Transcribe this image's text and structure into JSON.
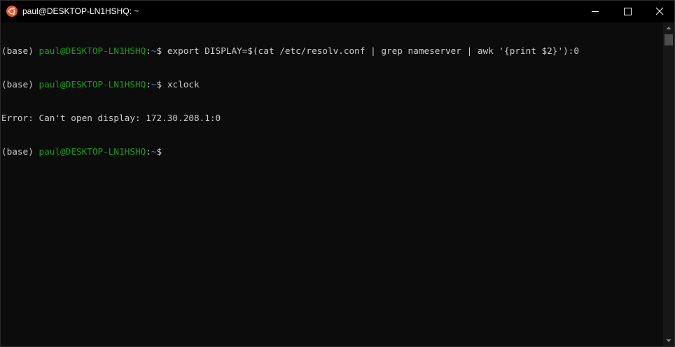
{
  "window": {
    "title": "paul@DESKTOP-LN1HSHQ: ~",
    "icon": "ubuntu-logo-icon",
    "controls": [
      "minimize-icon",
      "maximize-icon",
      "close-icon"
    ]
  },
  "colors": {
    "background": "#0c0c0c",
    "foreground": "#cccccc",
    "prompt_user": "#13a10e",
    "prompt_path": "#3b78ff",
    "ubuntu_orange": "#e95420"
  },
  "terminal": {
    "lines": [
      {
        "env": "(base) ",
        "user_host": "paul@DESKTOP-LN1HSHQ",
        "colon": ":",
        "path": "~",
        "dollar": "$ ",
        "command": "export DISPLAY=$(cat /etc/resolv.conf | grep nameserver | awk '{print $2}'):0"
      },
      {
        "env": "(base) ",
        "user_host": "paul@DESKTOP-LN1HSHQ",
        "colon": ":",
        "path": "~",
        "dollar": "$ ",
        "command": "xclock"
      },
      {
        "output": "Error: Can't open display: 172.30.208.1:0"
      },
      {
        "env": "(base) ",
        "user_host": "paul@DESKTOP-LN1HSHQ",
        "colon": ":",
        "path": "~",
        "dollar": "$",
        "command": ""
      }
    ]
  }
}
